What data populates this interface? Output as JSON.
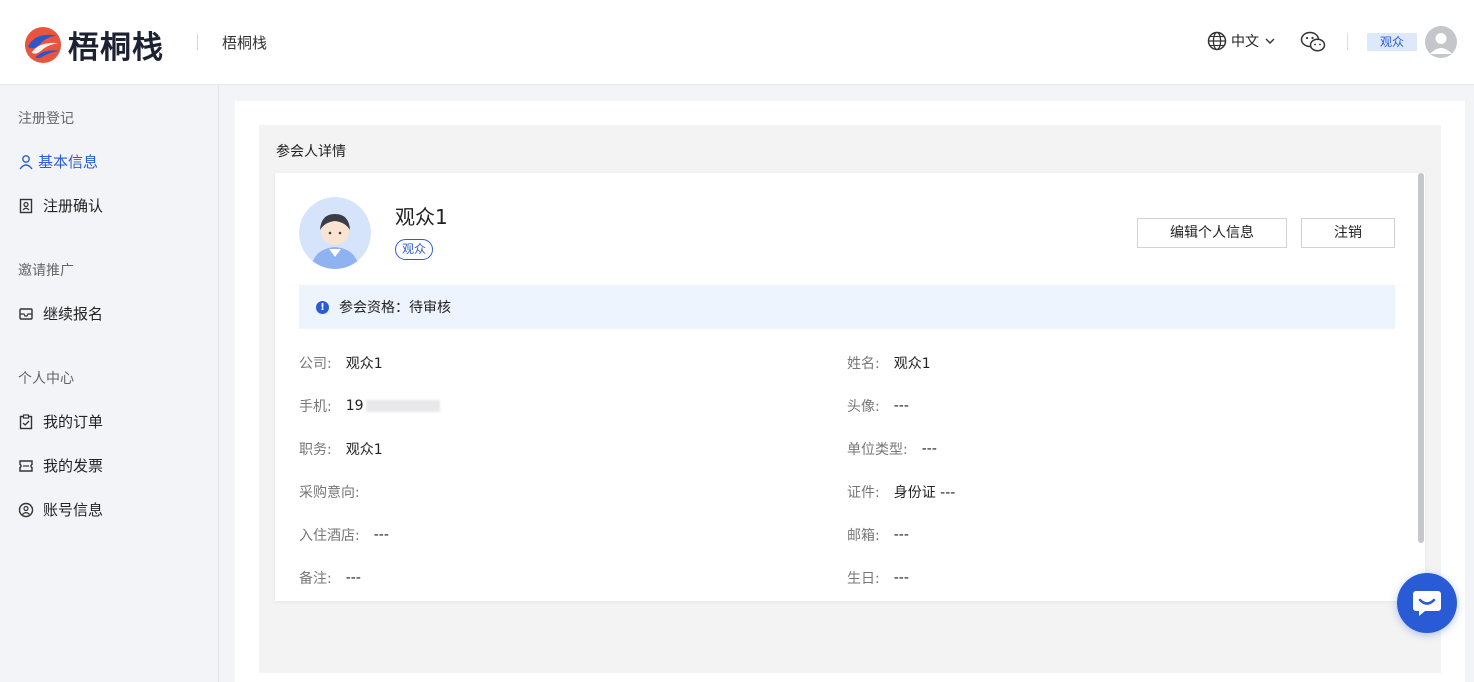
{
  "header": {
    "logo_text": "梧桐栈",
    "site_name": "梧桐栈",
    "language": "中文",
    "role_badge": "观众"
  },
  "sidebar": {
    "groups": [
      {
        "title": "注册登记",
        "items": [
          {
            "label": "基本信息",
            "icon": "user-icon",
            "active": true
          },
          {
            "label": "注册确认",
            "icon": "badge-icon",
            "active": false
          }
        ]
      },
      {
        "title": "邀请推广",
        "items": [
          {
            "label": "继续报名",
            "icon": "inbox-icon",
            "active": false
          }
        ]
      },
      {
        "title": "个人中心",
        "items": [
          {
            "label": "我的订单",
            "icon": "clipboard-check-icon",
            "active": false
          },
          {
            "label": "我的发票",
            "icon": "ticket-icon",
            "active": false
          },
          {
            "label": "账号信息",
            "icon": "user-circle-icon",
            "active": false
          }
        ]
      }
    ]
  },
  "detail": {
    "title": "参会人详情",
    "name": "观众1",
    "tag": "观众",
    "edit_button": "编辑个人信息",
    "cancel_button": "注销",
    "alert": "参会资格：待审核",
    "fields": {
      "company": {
        "label": "公司:",
        "value": "观众1"
      },
      "name": {
        "label": "姓名:",
        "value": "观众1"
      },
      "phone": {
        "label": "手机:",
        "value": "19"
      },
      "avatar": {
        "label": "头像:",
        "value": "---"
      },
      "position": {
        "label": "职务:",
        "value": "观众1"
      },
      "unit_type": {
        "label": "单位类型:",
        "value": "---"
      },
      "purchase": {
        "label": "采购意向:",
        "value": ""
      },
      "certificate": {
        "label": "证件:",
        "value": "身份证 ---"
      },
      "hotel": {
        "label": "入住酒店:",
        "value": "---"
      },
      "email": {
        "label": "邮箱:",
        "value": "---"
      },
      "remark": {
        "label": "备注:",
        "value": "---"
      },
      "birthday": {
        "label": "生日:",
        "value": "---"
      }
    }
  },
  "colors": {
    "accent": "#2a5bd7",
    "alert_bg": "#eef4fd",
    "panel_bg": "#f3f3f3"
  }
}
